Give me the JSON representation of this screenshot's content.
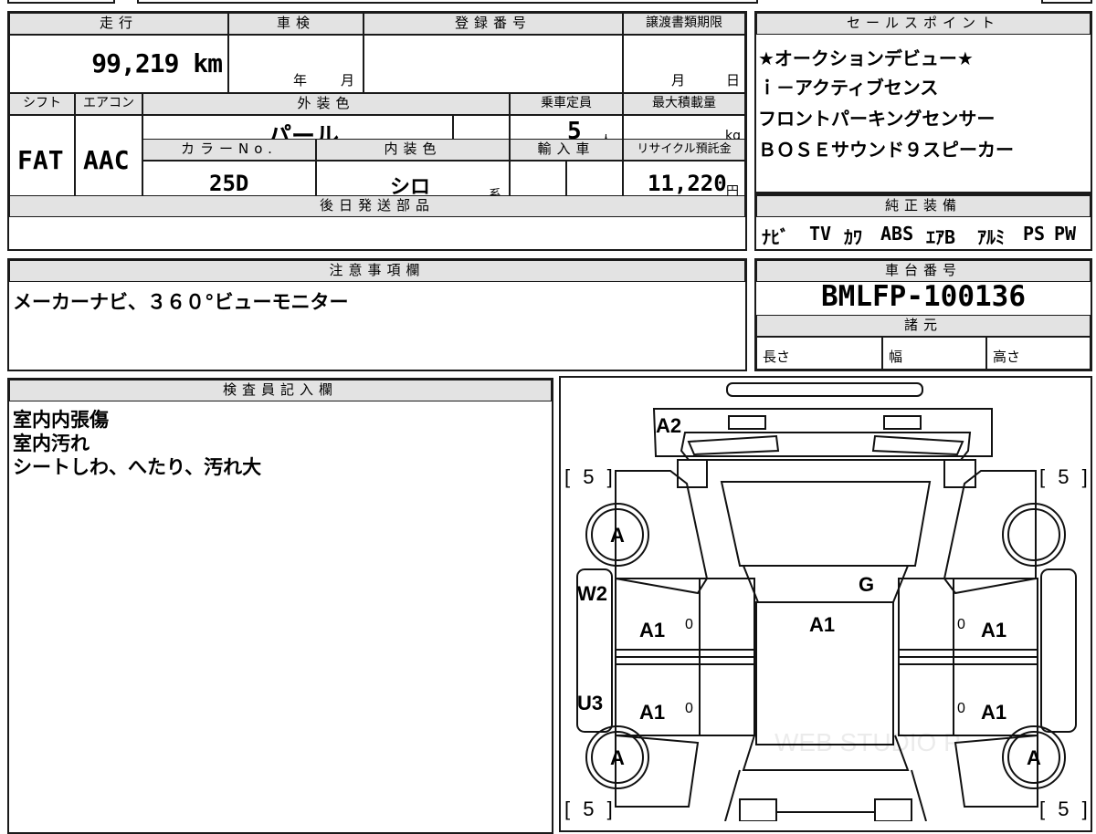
{
  "top_strip": {
    "partial_text": "",
    "partial_text_2": ""
  },
  "vehicle": {
    "headers": {
      "mileage": "走行",
      "inspection": "車検",
      "reg_number": "登録番号",
      "transfer_deadline": "譲渡書類期限",
      "shift": "シフト",
      "aircon": "エアコン",
      "ext_color": "外装色",
      "capacity": "乗車定員",
      "max_load": "最大積載量",
      "color_no": "カラーNo.",
      "int_color": "内装色",
      "import": "輸入車",
      "recycle": "リサイクル預託金",
      "delivery_parts": "後日発送部品"
    },
    "mileage": "99,219 km",
    "inspection_year": "年",
    "inspection_month": "月",
    "transfer_month": "月",
    "transfer_day": "日",
    "shift": "FAT",
    "aircon": "AAC",
    "ext_color": "パール",
    "capacity": "5",
    "capacity_unit": "人",
    "max_load_unit": "kg",
    "color_no": "25D",
    "int_color": "シロ",
    "int_color_suffix": "系",
    "recycle_fee": "11,220",
    "recycle_unit": "円"
  },
  "sales_points": {
    "header": "セールスポイント",
    "lines": [
      "★オークションデビュー★",
      "ｉ－アクティブセンス",
      "フロントパーキングセンサー",
      "ＢＯＳＥサウンド９スピーカー"
    ]
  },
  "equipment": {
    "header": "純正装備",
    "items": [
      "ﾅﾋﾞ",
      "TV",
      "ｶﾜ",
      "ABS",
      "ｴｱB",
      "ｱﾙﾐ",
      "PS",
      "PW"
    ]
  },
  "notes": {
    "header": "注意事項欄",
    "text": "メーカーナビ、３６０°ビューモニター"
  },
  "chassis": {
    "header": "車台番号",
    "number": "BMLFP-100136",
    "spec_header": "諸元",
    "length": "長さ",
    "width": "幅",
    "height": "高さ"
  },
  "inspector": {
    "header": "検査員記入欄",
    "lines": [
      "室内内張傷",
      "室内汚れ",
      "シートしわ、へたり、汚れ大"
    ]
  },
  "diagram": {
    "tire_front_left": "[ 5 ]",
    "tire_front_right": "[ 5 ]",
    "tire_rear_left": "[ 5 ]",
    "tire_rear_right": "[ 5 ]",
    "marks": {
      "front_bumper": "A2",
      "front_left_wheel": "A",
      "rear_left_wheel": "A",
      "rear_right_wheel": "A",
      "windshield": "G",
      "roof": "A1",
      "left_sill_upper": "W2",
      "left_sill_lower": "U3",
      "left_front_door": "A1",
      "left_rear_door": "A1",
      "right_front_door": "A1",
      "right_rear_door": "A1",
      "door_zero_1": "0",
      "door_zero_2": "0",
      "door_zero_3": "0",
      "door_zero_4": "0"
    },
    "watermark": "WEB STUDIO P"
  }
}
